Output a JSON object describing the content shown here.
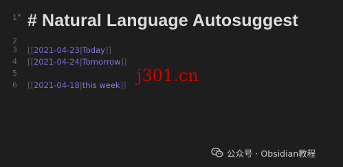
{
  "editor": {
    "line_numbers": [
      "1",
      "2",
      "3",
      "4",
      "5",
      "6"
    ],
    "heading": "# Natural Language Autosuggest",
    "links": [
      {
        "target": "2021-04-23",
        "alias": "Today"
      },
      {
        "target": "2021-04-24",
        "alias": "Tomorrow"
      },
      {
        "target": "2021-04-18",
        "alias": "this week"
      }
    ],
    "link_open": "[[",
    "link_sep": "|",
    "link_close": "]]"
  },
  "watermark": {
    "text": "j301.cn",
    "brand": "公众号 · Obsidian教程"
  },
  "colors": {
    "background": "#1e1e1e",
    "heading": "#dcddde",
    "link_target": "#7b6cd9",
    "watermark": "#d40000"
  },
  "icons": {
    "fold": "fold-arrow-icon",
    "brand": "wechat-icon"
  }
}
